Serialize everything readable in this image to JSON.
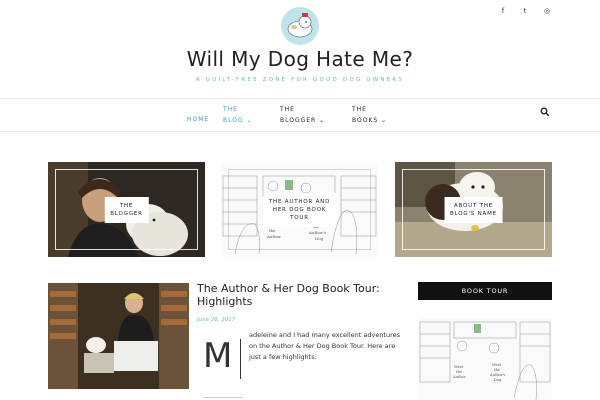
{
  "site": {
    "title": "Will My Dog Hate Me?",
    "tagline": "A GUILT-FREE ZONE FOR GOOD DOG OWNERS"
  },
  "social": [
    {
      "icon": "facebook-icon",
      "glyph": "f"
    },
    {
      "icon": "twitter-icon",
      "glyph": "t"
    },
    {
      "icon": "instagram-icon",
      "glyph": "◎"
    }
  ],
  "nav": {
    "items": [
      {
        "label": "HOME",
        "active": true
      },
      {
        "label": "THE BLOG",
        "active": true,
        "dropdown": true
      },
      {
        "label": "THE BLOGGER",
        "active": false,
        "dropdown": true
      },
      {
        "label": "THE BOOKS",
        "active": false,
        "dropdown": true
      }
    ],
    "item0": "HOME",
    "item1a": "THE",
    "item1b": "BLOG",
    "item2a": "THE",
    "item2b": "BLOGGER",
    "item3a": "THE",
    "item3b": "BOOKS",
    "caret": "⌄"
  },
  "features": [
    {
      "label": "THE\nBLOGGER"
    },
    {
      "label": "THE AUTHOR AND\nHER DOG BOOK\nTOUR"
    },
    {
      "label": "ABOUT THE\nBLOG'S NAME"
    }
  ],
  "illustration_text": {
    "author": "the\nAuthor",
    "authors_dog": "the\nAuthor's\nDog",
    "meet_author": "Meet\nthe\nAuthor",
    "meet_dog": "Meet\nthe\nAuthor's\nDog"
  },
  "post": {
    "title": "The Author & Her Dog Book Tour: Highlights",
    "date": "June 28, 2017",
    "dropcap": "M",
    "excerpt": "adeleine and I had many excellent adventures on the Author & Her Dog Book Tour. Here are just a few highlights:"
  },
  "sidebar": {
    "widget_title": "BOOK TOUR"
  },
  "colors": {
    "accent": "#6fb5c2",
    "nav_active": "#3a9bb0",
    "widget_bg": "#111111"
  }
}
